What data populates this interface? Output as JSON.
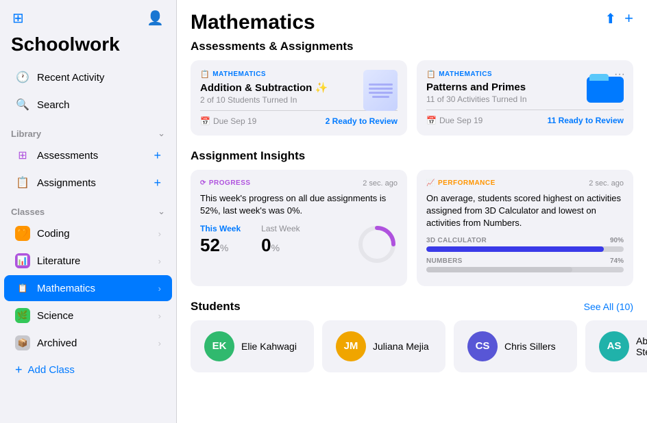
{
  "app": {
    "title": "Schoolwork"
  },
  "sidebar": {
    "nav": [
      {
        "id": "recent-activity",
        "label": "Recent Activity",
        "icon": "🕐"
      },
      {
        "id": "search",
        "label": "Search",
        "icon": "🔍"
      }
    ],
    "library": {
      "title": "Library",
      "items": [
        {
          "id": "assessments",
          "label": "Assessments",
          "icon": "📊"
        },
        {
          "id": "assignments",
          "label": "Assignments",
          "icon": "📋"
        }
      ]
    },
    "classes": {
      "title": "Classes",
      "items": [
        {
          "id": "coding",
          "label": "Coding",
          "color": "orange"
        },
        {
          "id": "literature",
          "label": "Literature",
          "color": "purple"
        },
        {
          "id": "mathematics",
          "label": "Mathematics",
          "color": "blue",
          "active": true
        },
        {
          "id": "science",
          "label": "Science",
          "color": "green"
        },
        {
          "id": "archived",
          "label": "Archived",
          "color": "gray"
        }
      ]
    },
    "add_class_label": "Add Class"
  },
  "main": {
    "title": "Mathematics",
    "assessments_section": {
      "header": "Assessments & Assignments",
      "cards": [
        {
          "id": "addition-subtraction",
          "tag": "MATHEMATICS",
          "title": "Addition & Subtraction ✨",
          "subtitle": "2 of 10 Students Turned In",
          "due": "Due Sep 19",
          "review_label": "2 Ready to Review"
        },
        {
          "id": "patterns-primes",
          "tag": "MATHEMATICS",
          "title": "Patterns and Primes",
          "subtitle": "11 of 30 Activities Turned In",
          "due": "Due Sep 19",
          "review_label": "11 Ready to Review"
        }
      ]
    },
    "insights_section": {
      "header": "Assignment Insights",
      "progress": {
        "tag": "PROGRESS",
        "time": "2 sec. ago",
        "text": "This week's progress on all due assignments is 52%, last week's was 0%.",
        "this_week_label": "This Week",
        "last_week_label": "Last Week",
        "this_week_value": "52",
        "last_week_value": "0",
        "unit": "%",
        "donut_percent": 52
      },
      "performance": {
        "tag": "PERFORMANCE",
        "time": "2 sec. ago",
        "text": "On average, students scored highest on activities assigned from 3D Calculator and lowest on activities from Numbers.",
        "bars": [
          {
            "label": "3D CALCULATOR",
            "pct": 90,
            "pct_label": "90%"
          },
          {
            "label": "NUMBERS",
            "pct": 74,
            "pct_label": "74%"
          }
        ]
      }
    },
    "students_section": {
      "header": "Students",
      "see_all_label": "See All (10)",
      "students": [
        {
          "initials": "EK",
          "name": "Elie Kahwagi",
          "color": "green"
        },
        {
          "initials": "JM",
          "name": "Juliana Mejia",
          "color": "yellow"
        },
        {
          "initials": "CS",
          "name": "Chris Sillers",
          "color": "purple"
        },
        {
          "initials": "AS",
          "name": "Abbi Stein",
          "color": "teal"
        }
      ]
    }
  }
}
